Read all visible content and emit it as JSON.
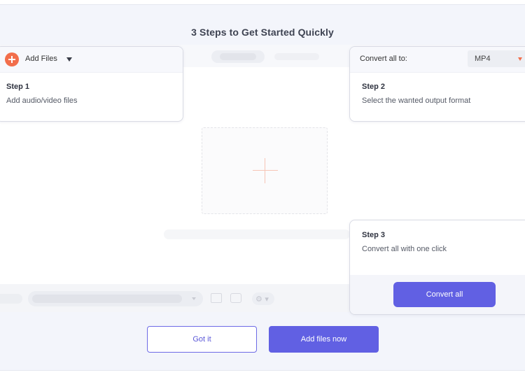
{
  "guide": {
    "title": "3 Steps to Get Started Quickly"
  },
  "step1": {
    "add_files_label": "Add Files",
    "step_label": "Step 1",
    "description": "Add audio/video files"
  },
  "step2": {
    "convert_all_to_label": "Convert all to:",
    "format_value": "MP4",
    "step_label": "Step 2",
    "description": "Select the wanted output format"
  },
  "step3": {
    "step_label": "Step 3",
    "description": "Convert all with one click",
    "convert_all_label": "Convert all"
  },
  "actions": {
    "got_it_label": "Got it",
    "add_files_now_label": "Add files now"
  },
  "icons": {
    "add": "plus-circle-icon",
    "dropzone_add": "plus-icon",
    "folder": "folder-icon",
    "merge": "merge-icon",
    "settings": "gear-icon"
  },
  "colors": {
    "accent": "#6160e3",
    "orange": "#f26e4b",
    "background": "#f3f5fb"
  }
}
